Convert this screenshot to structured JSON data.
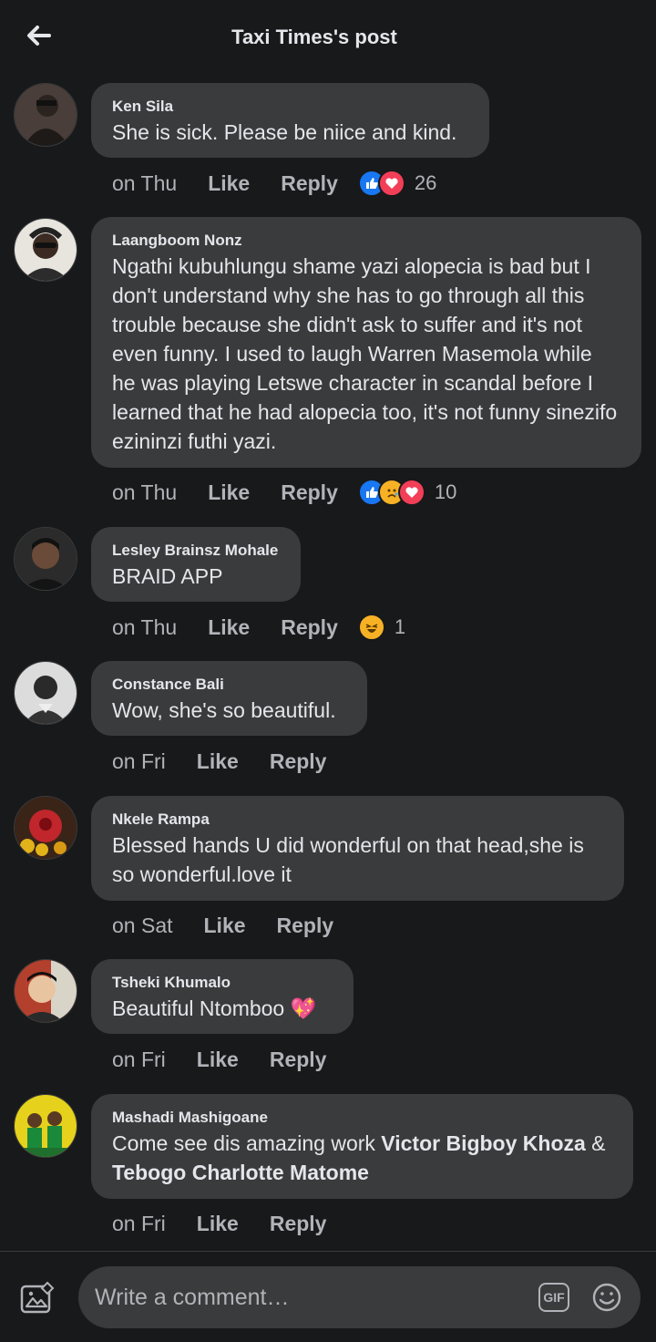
{
  "header": {
    "title": "Taxi Times's post"
  },
  "comments": [
    {
      "name": "Ken Sila",
      "text": "She is sick. Please be niice and kind.",
      "time": "on Thu",
      "like": "Like",
      "reply": "Reply",
      "reaction_count": "26"
    },
    {
      "name": "Laangboom Nonz",
      "text": "Ngathi kubuhlungu shame yazi alopecia is bad but I don't understand why she has to go through all this trouble because she didn't ask to suffer and it's not even funny. I used to laugh Warren Masemola while he was playing Letswe character in scandal  before I learned that he had alopecia too, it's not funny sinezifo ezininzi futhi yazi.",
      "time": "on Thu",
      "like": "Like",
      "reply": "Reply",
      "reaction_count": "10"
    },
    {
      "name": "Lesley Brainsz Mohale",
      "text": "BRAID APP",
      "time": "on Thu",
      "like": "Like",
      "reply": "Reply",
      "reaction_count": "1"
    },
    {
      "name": "Constance Bali",
      "text": "Wow, she's so beautiful.",
      "time": "on Fri",
      "like": "Like",
      "reply": "Reply"
    },
    {
      "name": "Nkele Rampa",
      "text": "Blessed hands U did wonderful on that head,she is so wonderful.love it",
      "time": "on Sat",
      "like": "Like",
      "reply": "Reply"
    },
    {
      "name": "Tsheki Khumalo",
      "text": "Beautiful Ntomboo",
      "emoji": "💖",
      "time": "on Fri",
      "like": "Like",
      "reply": "Reply"
    },
    {
      "name": "Mashadi Mashigoane",
      "text_pre": "Come see dis amazing work ",
      "mention1": "Victor Bigboy Khoza",
      "text_mid": " & ",
      "mention2": "Tebogo Charlotte Matome",
      "time": "on Fri",
      "like": "Like",
      "reply": "Reply"
    }
  ],
  "composer": {
    "placeholder": "Write a comment…",
    "gif_label": "GIF"
  },
  "icons": {
    "back": "back-arrow-icon",
    "photo": "photo-icon",
    "gif": "gif-icon",
    "emoji": "emoji-icon",
    "like_reaction": "like-reaction-icon",
    "love_reaction": "love-reaction-icon",
    "sad_reaction": "sad-reaction-icon",
    "haha_reaction": "haha-reaction-icon"
  },
  "colors": {
    "background": "#18191a",
    "bubble": "#3a3b3c",
    "like_blue": "#1877f2",
    "love_red": "#f33e58",
    "haha_yellow": "#f7b125"
  }
}
